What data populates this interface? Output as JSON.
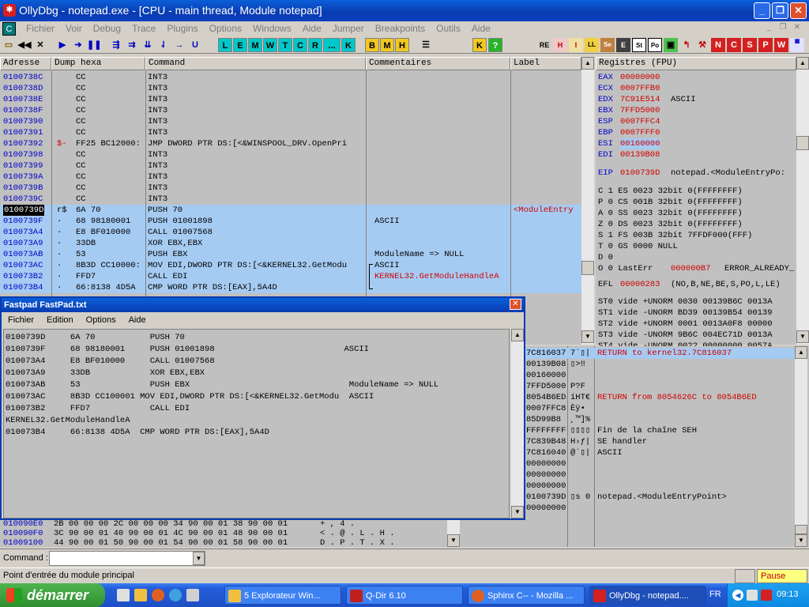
{
  "window": {
    "title": "OllyDbg - notepad.exe - [CPU - main thread, Module notepad]"
  },
  "menu": [
    "Fichier",
    "Voir",
    "Debug",
    "Trace",
    "Plugins",
    "Options",
    "Windows",
    "Aide",
    "Jumper",
    "Breakpoints",
    "Outils",
    "Aide"
  ],
  "toolbar": {
    "letters": [
      "L",
      "E",
      "M",
      "W",
      "T",
      "C",
      "R",
      "...",
      "K"
    ],
    "bmh": [
      "B",
      "M",
      "H"
    ],
    "extra": [
      "K",
      "?"
    ],
    "right": [
      "RE",
      "H",
      "I",
      "LL",
      "Se",
      "E",
      "St",
      "Po"
    ]
  },
  "disasm": {
    "headers": [
      "Adresse",
      "Dump hexa",
      "Command",
      "Commentaires",
      "Label"
    ],
    "rows": [
      {
        "addr": "0100738C",
        "mark": "",
        "hex": "CC",
        "cmd": "INT3",
        "comment": "",
        "label": ""
      },
      {
        "addr": "0100738D",
        "mark": "",
        "hex": "CC",
        "cmd": "INT3",
        "comment": "",
        "label": ""
      },
      {
        "addr": "0100738E",
        "mark": "",
        "hex": "CC",
        "cmd": "INT3",
        "comment": "",
        "label": ""
      },
      {
        "addr": "0100738F",
        "mark": "",
        "hex": "CC",
        "cmd": "INT3",
        "comment": "",
        "label": ""
      },
      {
        "addr": "01007390",
        "mark": "",
        "hex": "CC",
        "cmd": "INT3",
        "comment": "",
        "label": ""
      },
      {
        "addr": "01007391",
        "mark": "",
        "hex": "CC",
        "cmd": "INT3",
        "comment": "",
        "label": ""
      },
      {
        "addr": "01007392",
        "mark": "$-",
        "hex": "FF25 BC12000:",
        "cmd": "JMP DWORD PTR DS:[<&WINSPOOL_DRV.OpenPri",
        "comment": "",
        "label": ""
      },
      {
        "addr": "01007398",
        "mark": "",
        "hex": "CC",
        "cmd": "INT3",
        "comment": "",
        "label": ""
      },
      {
        "addr": "01007399",
        "mark": "",
        "hex": "CC",
        "cmd": "INT3",
        "comment": "",
        "label": ""
      },
      {
        "addr": "0100739A",
        "mark": "",
        "hex": "CC",
        "cmd": "INT3",
        "comment": "",
        "label": ""
      },
      {
        "addr": "0100739B",
        "mark": "",
        "hex": "CC",
        "cmd": "INT3",
        "comment": "",
        "label": ""
      },
      {
        "addr": "0100739C",
        "mark": "",
        "hex": "CC",
        "cmd": "INT3",
        "comment": "",
        "label": ""
      },
      {
        "addr": "0100739D",
        "mark": "r$",
        "hex": "6A 70",
        "cmd": "PUSH 70",
        "comment": "",
        "label": "<ModuleEntry"
      },
      {
        "addr": "0100739F",
        "mark": "·",
        "hex": "68 98180001",
        "cmd": "PUSH 01001898",
        "comment": "ASCII",
        "label": ""
      },
      {
        "addr": "010073A4",
        "mark": "·",
        "hex": "E8 BF010000",
        "cmd": "CALL 01007568",
        "comment": "",
        "label": ""
      },
      {
        "addr": "010073A9",
        "mark": "·",
        "hex": "33DB",
        "cmd": "XOR EBX,EBX",
        "comment": "",
        "label": ""
      },
      {
        "addr": "010073AB",
        "mark": "·",
        "hex": "53",
        "cmd": "PUSH EBX",
        "comment": "ModuleName => NULL",
        "label": ""
      },
      {
        "addr": "010073AC",
        "mark": "·",
        "hex": "8B3D CC10000:",
        "cmd": "MOV EDI,DWORD PTR DS:[<&KERNEL32.GetModu",
        "comment": "ASCII",
        "label": ""
      },
      {
        "addr": "010073B2",
        "mark": "·",
        "hex": "FFD7",
        "cmd": "CALL EDI",
        "comment": "KERNEL32.GetModuleHandleA",
        "label": ""
      },
      {
        "addr": "010073B4",
        "mark": "·",
        "hex": "66:8138 4D5A",
        "cmd": "CMP WORD PTR DS:[EAX],5A4D",
        "comment": "",
        "label": ""
      }
    ]
  },
  "registers": {
    "header": "Registres (FPU)",
    "gp": [
      {
        "name": "EAX",
        "val": "00000000",
        "extra": ""
      },
      {
        "name": "ECX",
        "val": "0007FFB0",
        "extra": ""
      },
      {
        "name": "EDX",
        "val": "7C91E514",
        "extra": "ASCII"
      },
      {
        "name": "EBX",
        "val": "7FFD5000",
        "extra": ""
      },
      {
        "name": "ESP",
        "val": "0007FFC4",
        "extra": ""
      },
      {
        "name": "EBP",
        "val": "0007FFF0",
        "extra": ""
      },
      {
        "name": "ESI",
        "val": "00160000",
        "extra": ""
      },
      {
        "name": "EDI",
        "val": "00139B08",
        "extra": ""
      }
    ],
    "eip": {
      "name": "EIP",
      "val": "0100739D",
      "extra": "notepad.<ModuleEntryPo:"
    },
    "flags": [
      "C 1  ES 0023 32bit 0(FFFFFFFF)",
      "P 0  CS 001B 32bit 0(FFFFFFFF)",
      "A 0  SS 0023 32bit 0(FFFFFFFF)",
      "Z 0  DS 0023 32bit 0(FFFFFFFF)",
      "S 1  FS 003B 32bit 7FFDF000(FFF)",
      "T 0  GS 0000 NULL",
      "D 0",
      "O 0  LastErr"
    ],
    "lasterr_val": "000000B7",
    "lasterr_name": "ERROR_ALREADY_",
    "efl": "EFL",
    "efl_val": "00000283",
    "efl_extra": "(NO,B,NE,BE,S,PO,L,LE)",
    "fpu": [
      "ST0 vide  +UNORM 0030 00139B6C 0013A",
      "ST1 vide  -UNORM BD39 00139B54 00139",
      "ST2 vide  +UNORM 0001 0013A0F8 00000",
      "ST3 vide  -UNORM 9B6C 004EC71D 0013A",
      "ST4 vide  -UNORM 0022 00000000 0057A"
    ]
  },
  "stack": {
    "rows": [
      {
        "addr": "7C816037",
        "ascii": "7`▯|",
        "comment": "RETURN to kernel32.7C816037"
      },
      {
        "addr": "00139B08",
        "ascii": "▯>‼",
        "comment": ""
      },
      {
        "addr": "00160000",
        "ascii": "",
        "comment": ""
      },
      {
        "addr": "7FFD5000",
        "ascii": " P?F",
        "comment": ""
      },
      {
        "addr": "8054B6ED",
        "ascii": "íHT€",
        "comment": "RETURN from 8054626C to 8054B6ED"
      },
      {
        "addr": "0007FFC8",
        "ascii": "Èÿ•",
        "comment": ""
      },
      {
        "addr": "85D99B8",
        "ascii": "¸™]%",
        "comment": ""
      },
      {
        "addr": "FFFFFFFF",
        "ascii": "▯▯▯▯",
        "comment": "Fin de la chaîne SEH"
      },
      {
        "addr": "7C839B48",
        "ascii": "H›ƒ|",
        "comment": "SE handler"
      },
      {
        "addr": "7C816040",
        "ascii": "@`▯|",
        "comment": "ASCII"
      },
      {
        "addr": "00000000",
        "ascii": "",
        "comment": ""
      },
      {
        "addr": "00000000",
        "ascii": "",
        "comment": ""
      },
      {
        "addr": "00000000",
        "ascii": "",
        "comment": ""
      },
      {
        "addr": "0100739D",
        "ascii": "▯s 0",
        "comment": "notepad.<ModuleEntryPoint>"
      },
      {
        "addr": "00000000",
        "ascii": "",
        "comment": ""
      }
    ]
  },
  "dump": {
    "rows": [
      {
        "addr": "010090E0",
        "hex": "2B 00 00 00  2C 00 00 00  34 90 00 01  38 90 00 01",
        "ascii": "+       ,       4 .     "
      },
      {
        "addr": "010090F0",
        "hex": "3C 90 00 01  40 90 00 01  4C 90 00 01  48 90 00 01",
        "ascii": "<  .  @ .  L .  H ."
      },
      {
        "addr": "01009100",
        "hex": "44 90 00 01  50 90 00 01  54 90 00 01  58 90 00 01",
        "ascii": "D .  P .  T .  X ."
      }
    ]
  },
  "fastpad": {
    "title": "Fastpad   FastPad.txt",
    "menu": [
      "Fichier",
      "Edition",
      "Options",
      "Aide"
    ],
    "lines": [
      "0100739D     6A 70           PUSH 70",
      "0100739F     68 98180001     PUSH 01001898                          ASCII",
      "010073A4     E8 BF010000     CALL 01007568",
      "010073A9     33DB            XOR EBX,EBX",
      "010073AB     53              PUSH EBX                                ModuleName => NULL",
      "010073AC     8B3D CC100001 MOV EDI,DWORD PTR DS:[<&KERNEL32.GetModu  ASCII",
      "010073B2     FFD7            CALL EDI",
      "KERNEL32.GetModuleHandleA",
      "010073B4     66:8138 4D5A  CMP WORD PTR DS:[EAX],5A4D"
    ]
  },
  "command": {
    "label": "Command :",
    "value": ""
  },
  "status": {
    "text": "Point d'entrée du module principal",
    "state": "Pause"
  },
  "taskbar": {
    "start": "démarrer",
    "tasks": [
      "5 Explorateur Win...",
      "Q-Dir 6.10",
      "Sphinx C-- - Mozilla ...",
      "OllyDbg - notepad...."
    ],
    "lang": "FR",
    "time": "09:13"
  },
  "colors": {
    "accent": "#0a3bb0",
    "selection": "#a6cbf2",
    "address": "#0000c8",
    "highlight_red": "#d00000"
  }
}
